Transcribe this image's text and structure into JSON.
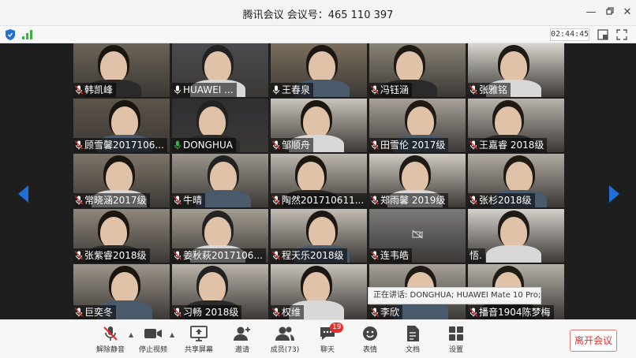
{
  "window": {
    "title": "腾讯会议 会议号：465 110 397"
  },
  "status": {
    "timer": "02:44:45"
  },
  "participants": [
    {
      "name": "韩凯峰",
      "mic": "muted"
    },
    {
      "name": "HUAWEI ...",
      "mic": "on"
    },
    {
      "name": "王春泉",
      "mic": "on"
    },
    {
      "name": "冯钰涵",
      "mic": "muted"
    },
    {
      "name": "张雅铭",
      "mic": "muted"
    },
    {
      "name": "顾雪馨2017106...",
      "mic": "muted"
    },
    {
      "name": "DONGHUA",
      "mic": "speaking"
    },
    {
      "name": "邹顺舟",
      "mic": "muted"
    },
    {
      "name": "田雪伦 2017级",
      "mic": "muted"
    },
    {
      "name": "王嘉睿 2018级",
      "mic": "muted"
    },
    {
      "name": "常晓涵2017级",
      "mic": "muted"
    },
    {
      "name": "牛晴",
      "mic": "muted"
    },
    {
      "name": "陶然201710611...",
      "mic": "muted"
    },
    {
      "name": "郑雨馨 2019级",
      "mic": "muted"
    },
    {
      "name": "张杉2018级",
      "mic": "muted"
    },
    {
      "name": "张紫睿2018级",
      "mic": "muted"
    },
    {
      "name": "姜秋萩2017106...",
      "mic": "muted"
    },
    {
      "name": "程天乐2018级",
      "mic": "muted"
    },
    {
      "name": "连韦皓",
      "mic": "muted"
    },
    {
      "name": "悟.",
      "mic": "none"
    },
    {
      "name": "巨奕冬",
      "mic": "muted"
    },
    {
      "name": "习畅 2018级",
      "mic": "muted"
    },
    {
      "name": "权维",
      "mic": "muted"
    },
    {
      "name": "李欣",
      "mic": "muted"
    },
    {
      "name": "播音1904陈梦梅",
      "mic": "muted"
    }
  ],
  "tooltip": {
    "text": "正在讲话: DONGHUA; HUAWEI Mate 10 Pro;"
  },
  "toolbar": {
    "unmute": "解除静音",
    "stop_video": "停止视频",
    "share": "共享屏幕",
    "invite": "邀请",
    "members": "成员(73)",
    "chat": "聊天",
    "chat_badge": "19",
    "reactions": "表情",
    "docs": "文档",
    "settings": "设置",
    "leave": "离开会议"
  },
  "colors": {
    "accent": "#1f6fd6",
    "leave": "#d9332f",
    "badge": "#e0302d",
    "signal": "#3cb043"
  }
}
